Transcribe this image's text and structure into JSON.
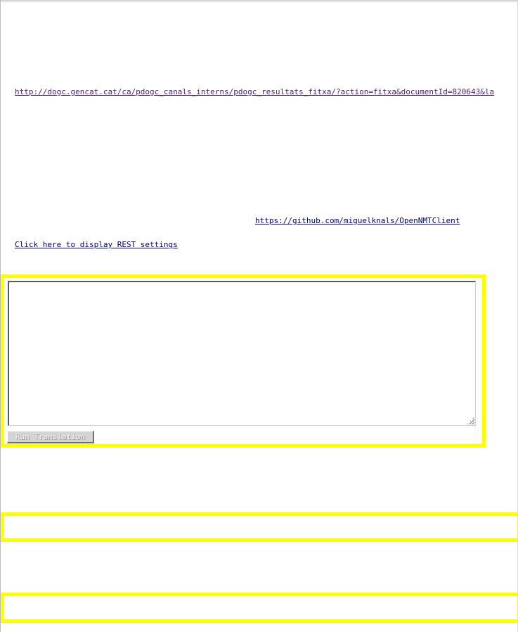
{
  "links": {
    "dogc_url": "http://dogc.gencat.cat/ca/pdogc_canals_interns/pdogc_resultats_fitxa/?action=fitxa&documentId=820643&la",
    "github_url": "https://github.com/miguelknals/OpenNMTClient",
    "rest_settings": "Click here to display REST settings"
  },
  "translation": {
    "input_value": "",
    "run_button_label": "Run Translation"
  },
  "colors": {
    "highlight_border": "#ffff00",
    "link": "#00007f",
    "visited_link": "#4b1d73"
  }
}
